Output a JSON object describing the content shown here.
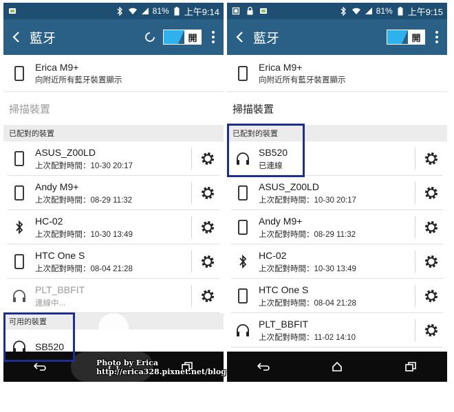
{
  "status_bar": {
    "battery_percent": "81%",
    "left_time": "上午9:14",
    "right_time": "上午9:15"
  },
  "app_bar": {
    "title": "藍牙",
    "toggle_label": "開"
  },
  "this_device": {
    "name": "Erica M9+",
    "subtitle": "向附近所有藍牙裝置顯示"
  },
  "scan_label": "掃描裝置",
  "left_screen": {
    "paired_header": "已配對的裝置",
    "paired": [
      {
        "name": "ASUS_Z00LD",
        "sub": "上次配對時間：10-30 20:17",
        "icon": "phone-icon"
      },
      {
        "name": "Andy M9+",
        "sub": "上次配對時間：08-29 11:32",
        "icon": "phone-icon"
      },
      {
        "name": "HC-02",
        "sub": "上次配對時間：10-30 13:49",
        "icon": "bluetooth-icon"
      },
      {
        "name": "HTC One S",
        "sub": "上次配對時間：08-04 21:28",
        "icon": "phone-icon"
      },
      {
        "name": "PLT_BBFIT",
        "sub": "連線中...",
        "icon": "headphones-icon"
      }
    ],
    "available_header": "可用的裝置",
    "available": [
      {
        "name": "SB520",
        "icon": "headphones-icon"
      }
    ]
  },
  "right_screen": {
    "paired_header": "已配對的裝置",
    "paired": [
      {
        "name": "SB520",
        "sub": "已連線",
        "icon": "headphones-icon"
      },
      {
        "name": "ASUS_Z00LD",
        "sub": "上次配對時間：10-30 20:17",
        "icon": "phone-icon"
      },
      {
        "name": "Andy M9+",
        "sub": "上次配對時間：08-29 11:32",
        "icon": "phone-icon"
      },
      {
        "name": "HC-02",
        "sub": "上次配對時間：10-30 13:49",
        "icon": "bluetooth-icon"
      },
      {
        "name": "HTC One S",
        "sub": "上次配對時間：08-04 21:28",
        "icon": "phone-icon"
      },
      {
        "name": "PLT_BBFIT",
        "sub": "上次配對時間：11-02 14:10",
        "icon": "headphones-icon"
      }
    ]
  },
  "watermark": {
    "line1": "Photo by Erica",
    "line2": "http://erica328.pixnet.net/blog"
  },
  "colors": {
    "status_bar": "#1e4f73",
    "app_bar": "#2a5f86",
    "toggle_accent": "#2fb1ee",
    "highlight_box": "#1c2e8f",
    "nav_bar": "#0c0c0c"
  }
}
